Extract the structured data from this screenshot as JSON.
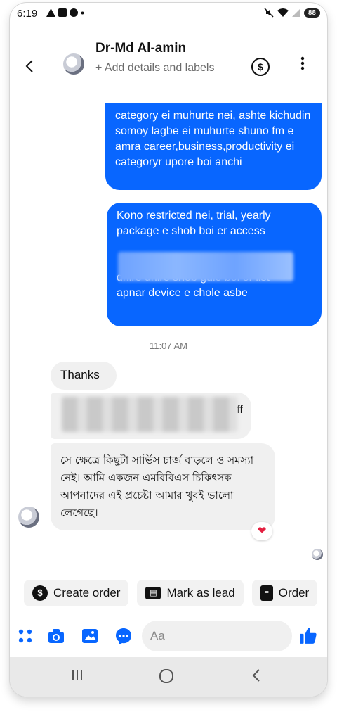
{
  "status_bar": {
    "time": "6:19",
    "battery": "88"
  },
  "header": {
    "contact_name": "Dr-Md Al-amin",
    "subtitle": "+ Add details and labels",
    "back_icon": "chevron-left-icon",
    "payment_icon": "dollar-circle-icon",
    "more_icon": "more-vertical-icon"
  },
  "messages": {
    "out_1": "category ei muhurte nei, ashte kichudin somoy lagbe ei muhurte shuno fm e amra career,business,productivity ei categoryr upore boi anchi",
    "out_2_line1": "Kono restricted nei, trial, yearly",
    "out_2_line2": "package e shob boi er access",
    "out_2_line5": "dhire dhire shob gulo boi er list",
    "out_2_line6": "apnar device e chole asbe",
    "timestamp": "11:07 AM",
    "in_1": "Thanks",
    "in_2_tail": "ff",
    "in_3": "সে ক্ষেত্রে কিছুটা সার্ভিস চার্জ বাড়লে ও সমস্যা নেই। আমি একজন এমবিবিএস চিকিৎসক আপনাদের এই প্রচেষ্টা আমার খুবই ভালো লেগেছে।",
    "reaction": "❤"
  },
  "quick_replies": [
    {
      "label": "Create order",
      "icon": "dollar-circle-icon"
    },
    {
      "label": "Mark as lead",
      "icon": "contact-card-icon"
    },
    {
      "label": "Order",
      "icon": "receipt-icon"
    }
  ],
  "composer": {
    "placeholder": "Aa"
  },
  "colors": {
    "accent": "#0866ff",
    "bubble_in": "#f0f0f0"
  }
}
